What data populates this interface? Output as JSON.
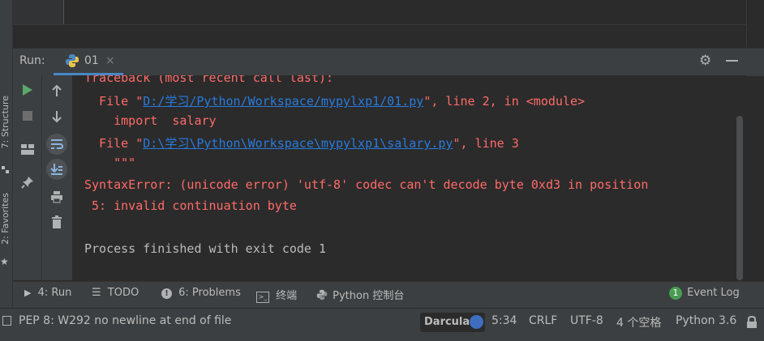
{
  "sidebar": {
    "structure_label": "7: Structure",
    "favorites_label": "2: Favorites"
  },
  "run_panel": {
    "title": "Run:",
    "tab_label": "01",
    "close_glyph": "×",
    "settings_glyph": "⚙"
  },
  "console": {
    "lines": [
      {
        "parts": [
          {
            "text": "Traceback (most recent call last):",
            "cls": "err"
          }
        ]
      },
      {
        "parts": [
          {
            "text": "  File \"",
            "cls": "err"
          },
          {
            "text": "D:/学习/Python/Workspace/mypylxp1/01.py",
            "cls": "lnk"
          },
          {
            "text": "\", line 2, in <module>",
            "cls": "err"
          }
        ]
      },
      {
        "parts": [
          {
            "text": "    import  salary",
            "cls": "err"
          }
        ]
      },
      {
        "parts": [
          {
            "text": "  File \"",
            "cls": "err"
          },
          {
            "text": "D:\\学习\\Python\\Workspace\\mypylxp1\\salary.py",
            "cls": "lnk"
          },
          {
            "text": "\", line 3",
            "cls": "err"
          }
        ]
      },
      {
        "parts": [
          {
            "text": "    \"\"\"",
            "cls": "err"
          }
        ]
      },
      {
        "parts": [
          {
            "text": "SyntaxError: (unicode error) 'utf-8' codec can't decode byte 0xd3 in position",
            "cls": "err"
          }
        ]
      },
      {
        "parts": [
          {
            "text": " 5: invalid continuation byte",
            "cls": "err"
          }
        ]
      },
      {
        "parts": [
          {
            "text": "",
            "cls": "norm"
          }
        ]
      },
      {
        "parts": [
          {
            "text": "Process finished with exit code 1",
            "cls": "norm"
          }
        ]
      }
    ]
  },
  "tool_windows": {
    "run": "4: Run",
    "todo": "TODO",
    "problems": "6: Problems",
    "terminal": "终端",
    "python_console": "Python 控制台",
    "event_log": "Event Log",
    "event_count": "1"
  },
  "status_bar": {
    "message": "PEP 8: W292 no newline at end of file",
    "theme": "Darcula",
    "position": "5:34",
    "line_sep": "CRLF",
    "encoding": "UTF-8",
    "indent": "4 个空格",
    "interpreter": "Python 3.6"
  },
  "colors": {
    "error": "#ff6b68",
    "link": "#287bde",
    "run_green": "#59a869",
    "accent": "#4a88c7"
  }
}
